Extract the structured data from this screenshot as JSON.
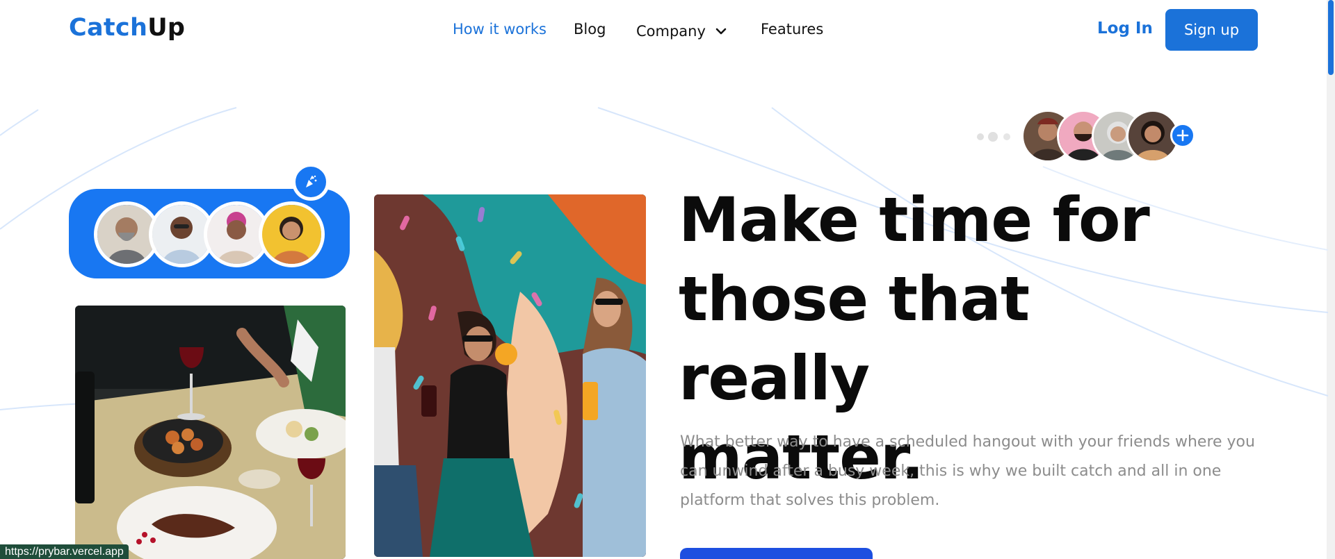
{
  "header": {
    "logo_part1": "Catch",
    "logo_part2": "Up",
    "nav": {
      "how_it_works": "How it works",
      "blog": "Blog",
      "company": "Company",
      "features": "Features"
    },
    "login": "Log In",
    "signup": "Sign up"
  },
  "hero": {
    "headline_line1": "Make time for",
    "headline_line2": "those that really",
    "headline_line3": "matter.",
    "subtext": "What better way to have a scheduled hangout with your friends where you can unwind after a busy week, this is why we built catch and all in one platform that solves this problem."
  },
  "status_bar": {
    "url": "https://prybar.vercel.app"
  },
  "colors": {
    "brand": "#1b72d9",
    "pill": "#1877f2",
    "cta": "#1d4fe0"
  }
}
